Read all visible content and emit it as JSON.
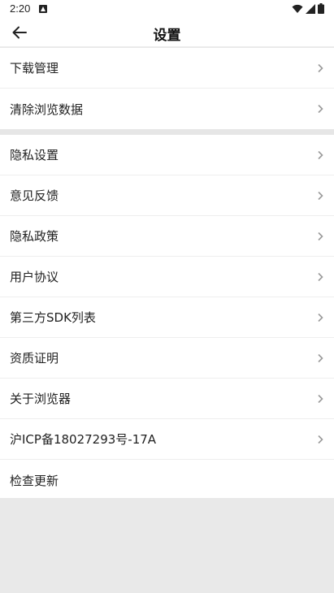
{
  "status_bar": {
    "time": "2:20"
  },
  "header": {
    "title": "设置"
  },
  "group1": [
    {
      "label": "下载管理"
    },
    {
      "label": "清除浏览数据"
    }
  ],
  "group2": [
    {
      "label": "隐私设置"
    },
    {
      "label": "意见反馈"
    },
    {
      "label": "隐私政策"
    },
    {
      "label": "用户协议"
    },
    {
      "label": "第三方SDK列表"
    },
    {
      "label": "资质证明"
    },
    {
      "label": "关于浏览器"
    },
    {
      "label": "沪ICP备18027293号-17A"
    },
    {
      "label": "检查更新"
    }
  ],
  "colors": {
    "background": "#e9e9e9",
    "row_bg": "#ffffff",
    "chevron": "#9a9a9a"
  }
}
